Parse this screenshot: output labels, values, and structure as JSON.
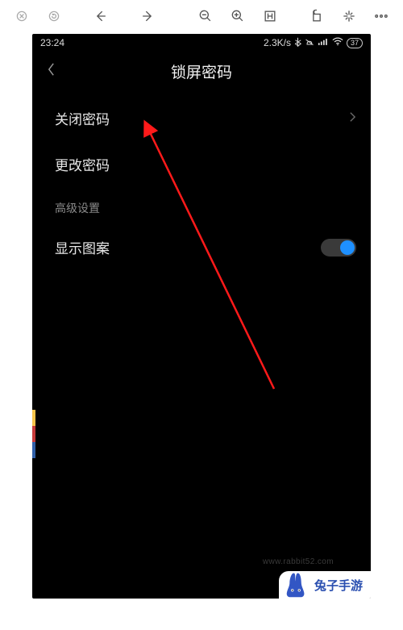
{
  "toolbar": {
    "icons": {
      "close": "close-circle-icon",
      "refresh": "refresh-circle-icon",
      "back": "back-arrow-icon",
      "forward": "forward-arrow-icon",
      "zoom_out": "zoom-out-icon",
      "zoom_in": "zoom-in-icon",
      "fit": "fit-width-icon",
      "rotate": "rotate-icon",
      "sparkle": "sparkle-icon",
      "more": "more-icon"
    }
  },
  "statusbar": {
    "time": "23:24",
    "net_speed": "2.3K/s",
    "battery_text": "37"
  },
  "header": {
    "title": "锁屏密码",
    "back_icon": "back-chevron-icon"
  },
  "settings": {
    "items": [
      {
        "label": "关闭密码",
        "has_chevron": true
      },
      {
        "label": "更改密码",
        "has_chevron": false
      }
    ],
    "section_label": "高级设置",
    "toggle_item": {
      "label": "显示图案",
      "on": true
    }
  },
  "brand": {
    "text": "兔子手游"
  },
  "watermark": {
    "text": "www.rabbit52.com"
  },
  "annotation": {
    "color": "#ff1a1a"
  }
}
